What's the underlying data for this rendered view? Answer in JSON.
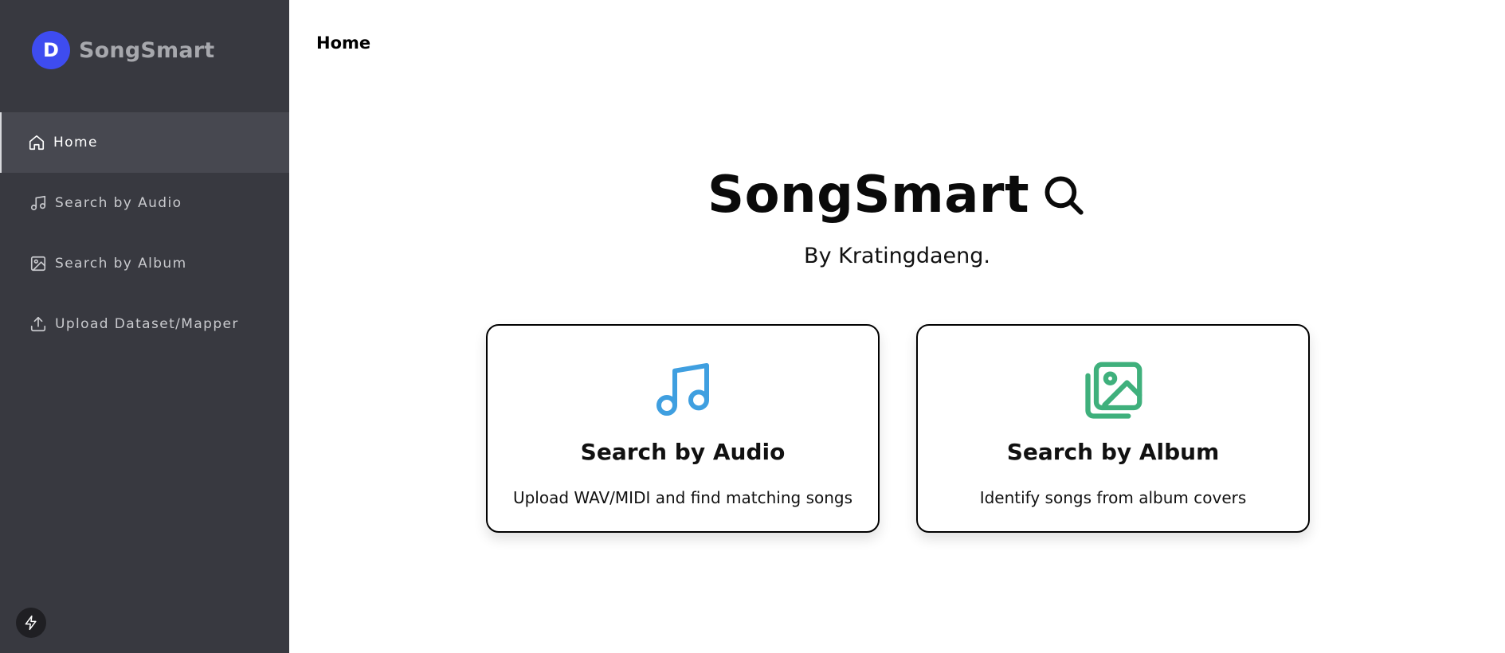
{
  "brand": {
    "logo_letter": "D",
    "name": "SongSmart"
  },
  "sidebar": {
    "items": [
      {
        "label": "Home",
        "icon": "home-icon",
        "active": true
      },
      {
        "label": "Search by Audio",
        "icon": "music-note-icon",
        "active": false
      },
      {
        "label": "Search by Album",
        "icon": "image-icon",
        "active": false
      },
      {
        "label": "Upload Dataset/Mapper",
        "icon": "upload-icon",
        "active": false
      }
    ],
    "footer_icon": "bolt-icon"
  },
  "header": {
    "title": "Home"
  },
  "hero": {
    "title": "SongSmart",
    "title_icon": "search-icon",
    "subtitle": "By Kratingdaeng."
  },
  "cards": [
    {
      "title": "Search by Audio",
      "description": "Upload WAV/MIDI and find matching songs",
      "icon": "music-notes-icon",
      "icon_color": "#3f9fe0"
    },
    {
      "title": "Search by Album",
      "description": "Identify songs from album covers",
      "icon": "images-icon",
      "icon_color": "#3fb07c"
    }
  ],
  "colors": {
    "sidebar_bg": "#383940",
    "sidebar_active_bg": "#474850",
    "brand_accent": "#3e4cf0"
  }
}
